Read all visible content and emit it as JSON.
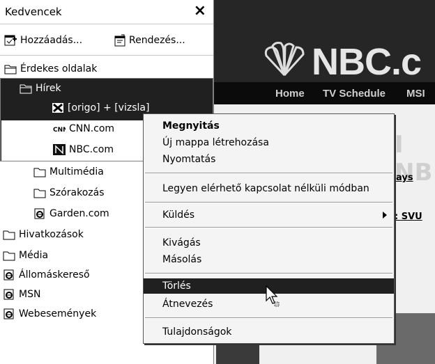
{
  "favorites_pane": {
    "title": "Kedvencek",
    "close": "×",
    "toolbar": {
      "add_label": "Hozzáadás...",
      "organize_label": "Rendezés..."
    },
    "tree": {
      "erdekes": "Érdekes oldalak",
      "hirek": "Hírek",
      "origo": "[origo] + [vizsla]",
      "cnn": "CNN.com",
      "nbc": "NBC.com",
      "multimedia": "Multimédia",
      "szorakozas": "Szórakozás",
      "garden": "Garden.com",
      "hivatkozasok": "Hivatkozások",
      "media": "Média",
      "allomaskereso": "Állomáskereső",
      "msn": "MSN",
      "webesemenyek": "Webesemények"
    }
  },
  "browser": {
    "logo": "NBC.c",
    "nav": [
      "Home",
      "TV Schedule",
      "MSI"
    ],
    "big_text": "I NB",
    "link1": "ays",
    "link2": ": SVU"
  },
  "context_menu": {
    "open": "Megnyitás",
    "new_folder": "Új mappa létrehozása",
    "print": "Nyomtatás",
    "offline": "Legyen elérhető kapcsolat nélküli módban",
    "send": "Küldés",
    "cut": "Kivágás",
    "copy": "Másolás",
    "delete": "Törlés",
    "rename": "Átnevezés",
    "properties": "Tulajdonságok"
  }
}
